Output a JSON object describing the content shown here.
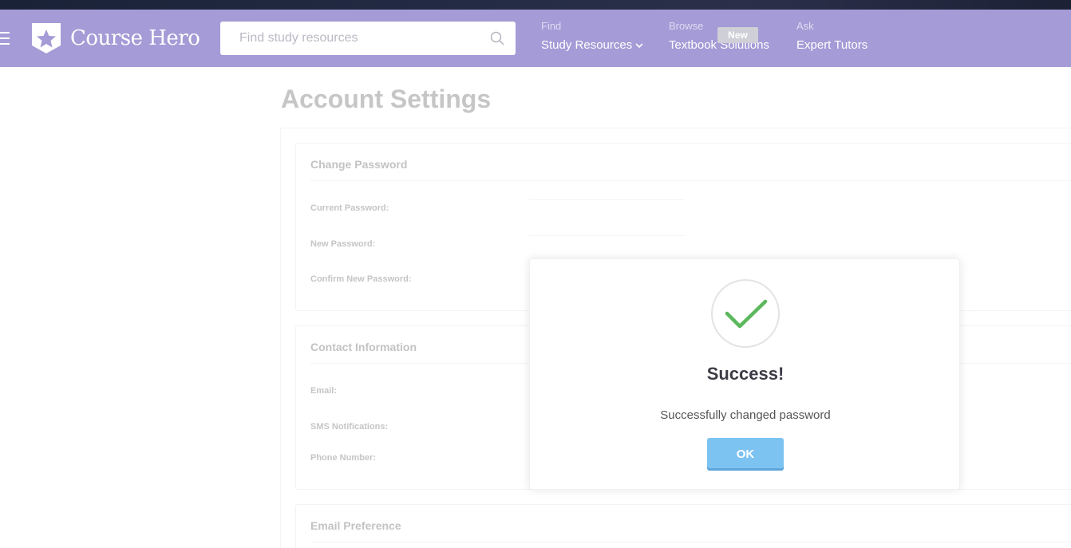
{
  "header": {
    "brand": "Course Hero",
    "search_placeholder": "Find study resources",
    "nav": [
      {
        "small": "Find",
        "label": "Study Resources"
      },
      {
        "small": "Browse",
        "label": "Textbook Solutions",
        "badge": "New"
      },
      {
        "small": "Ask",
        "label": "Expert Tutors"
      }
    ]
  },
  "page": {
    "title": "Account Settings",
    "sections": {
      "change_password": {
        "title": "Change Password",
        "fields": [
          "Current Password:",
          "New Password:",
          "Confirm New Password:"
        ]
      },
      "contact": {
        "title": "Contact Information",
        "fields": [
          "Email:",
          "SMS Notifications:",
          "Phone Number:"
        ]
      },
      "email_pref": {
        "title": "Email Preference"
      }
    }
  },
  "modal": {
    "title": "Success!",
    "message": "Successfully changed password",
    "ok_label": "OK"
  },
  "colors": {
    "header_bg": "#a59bd6",
    "success_green": "#5cb85c",
    "ok_button": "#7cc3f2"
  }
}
